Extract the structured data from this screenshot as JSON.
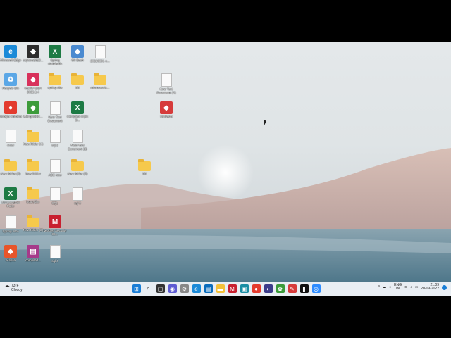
{
  "desktop": {
    "icons": [
      {
        "label": "Microsoft Edge",
        "type": "edge",
        "color": "#1b8ad8"
      },
      {
        "label": "Recycle Bin",
        "type": "recycle",
        "color": "#5aa7e6"
      },
      {
        "label": "Google Chrome",
        "type": "chrome",
        "color": "#e33b2e"
      },
      {
        "label": "oracl",
        "type": "doc",
        "color": "#fafafa"
      },
      {
        "label": "New folder (3)",
        "type": "folder",
        "color": "#f6c94c"
      },
      {
        "label": "Java Custom Patte",
        "type": "excel",
        "color": "#1d7a44"
      },
      {
        "label": "Spring intro",
        "type": "doc",
        "color": "#fafafa"
      },
      {
        "label": "eclipse",
        "type": "app",
        "color": "#e8552a"
      },
      {
        "label": "capture2022...",
        "type": "app",
        "color": "#2d2d2d"
      },
      {
        "label": "IntelliJ IDEA 2022.1.4",
        "type": "app",
        "color": "#d8315b"
      },
      {
        "label": "MongoDBC...",
        "type": "app",
        "color": "#3c9b3a"
      },
      {
        "label": "New folder (4)",
        "type": "folder",
        "color": "#f6c94c"
      },
      {
        "label": "New folder",
        "type": "folder",
        "color": "#f6c94c"
      },
      {
        "label": "boot-jdbc",
        "type": "folder",
        "color": "#f6c94c"
      },
      {
        "label": "New folder (2)",
        "type": "folder",
        "color": "#f6c94c"
      },
      {
        "label": "compiled...",
        "type": "winrar",
        "color": "#a63a8a"
      },
      {
        "label": "Spring standards",
        "type": "excel",
        "color": "#1d7a44"
      },
      {
        "label": "spring site",
        "type": "folder",
        "color": "#f6c94c"
      },
      {
        "label": "New Text Document",
        "type": "doc",
        "color": "#fafafa"
      },
      {
        "label": "sql 2",
        "type": "doc",
        "color": "#fafafa"
      },
      {
        "label": "ABC new",
        "type": "doc",
        "color": "#fafafa"
      },
      {
        "label": "SQL",
        "type": "doc",
        "color": "#fafafa"
      },
      {
        "label": "McAfee Security Sc...",
        "type": "mcafee",
        "color": "#c8202f"
      },
      {
        "label": "sql 4",
        "type": "doc",
        "color": "#fafafa"
      },
      {
        "label": "Git Bash",
        "type": "app",
        "color": "#4a8ad0"
      },
      {
        "label": "ISI",
        "type": "folder",
        "color": "#f6c94c"
      },
      {
        "label": "Complete topic S...",
        "type": "excel",
        "color": "#1d7a44"
      },
      {
        "label": "New Text Document (3)",
        "type": "doc",
        "color": "#fafafa"
      },
      {
        "label": "New folder (5)",
        "type": "folder",
        "color": "#f6c94c"
      },
      {
        "label": "sql 3",
        "type": "doc",
        "color": "#fafafa"
      },
      {
        "label": "20220301 e...",
        "type": "doc",
        "color": "#fafafa"
      },
      {
        "label": "microservic...",
        "type": "folder",
        "color": "#f6c94c"
      },
      {
        "label": "ISI",
        "type": "folder",
        "color": "#f6c94c"
      },
      {
        "label": "New Text Document (2)",
        "type": "doc",
        "color": "#fafafa"
      },
      {
        "label": "UnPaste",
        "type": "app",
        "color": "#d63b3b"
      }
    ]
  },
  "taskbar": {
    "weather_temp": "73°F",
    "weather_desc": "Cloudy",
    "lang_top": "ENG",
    "lang_bottom": "IN",
    "time": "21:09",
    "date": "20-09-2022"
  }
}
